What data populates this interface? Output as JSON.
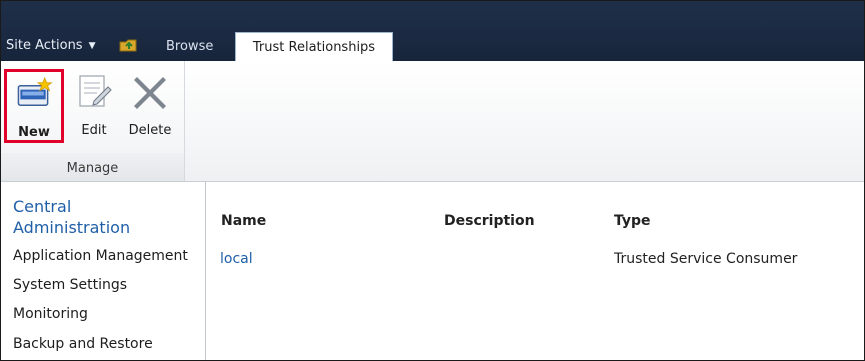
{
  "topbar": {
    "site_actions": "Site Actions",
    "tabs": [
      {
        "label": "Browse"
      },
      {
        "label": "Trust Relationships",
        "active": true
      }
    ]
  },
  "ribbon": {
    "group_label": "Manage",
    "buttons": [
      {
        "label": "New",
        "icon": "new-item-icon",
        "highlighted": true
      },
      {
        "label": "Edit",
        "icon": "edit-icon"
      },
      {
        "label": "Delete",
        "icon": "delete-icon"
      }
    ]
  },
  "leftnav": {
    "heading": "Central Administration",
    "items": [
      {
        "label": "Application Management"
      },
      {
        "label": "System Settings"
      },
      {
        "label": "Monitoring"
      },
      {
        "label": "Backup and Restore"
      }
    ]
  },
  "table": {
    "headers": [
      "Name",
      "Description",
      "Type"
    ],
    "rows": [
      {
        "name": "local",
        "description": "",
        "type": "Trusted Service Consumer"
      }
    ]
  },
  "colors": {
    "topbar": "#1b2a42",
    "link": "#1f5fa8",
    "highlight": "#e0002a"
  }
}
